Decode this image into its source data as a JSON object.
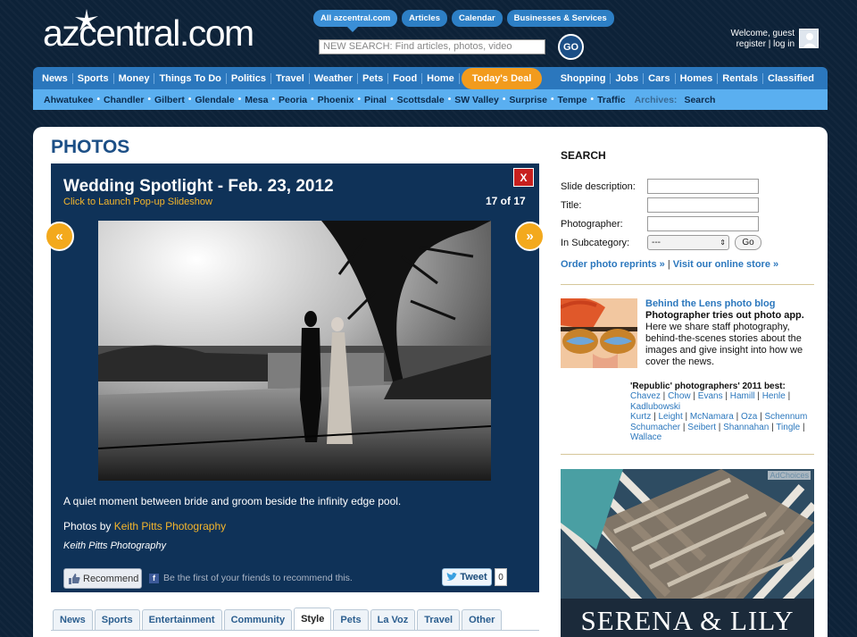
{
  "header": {
    "logo": "azcentral.com",
    "top_tabs": [
      "All azcentral.com",
      "Articles",
      "Calendar",
      "Businesses & Services"
    ],
    "search_placeholder": "NEW SEARCH: Find articles, photos, video",
    "go_label": "GO",
    "welcome_line1": "Welcome, guest",
    "welcome_line2": "register | log in"
  },
  "nav_primary": {
    "left": [
      "News",
      "Sports",
      "Money",
      "Things To Do",
      "Politics",
      "Travel",
      "Weather",
      "Pets",
      "Food",
      "Home"
    ],
    "deal": "Today's Deal",
    "right": [
      "Shopping",
      "Jobs",
      "Cars",
      "Homes",
      "Rentals",
      "Classified"
    ]
  },
  "nav_secondary": {
    "items": [
      "Ahwatukee",
      "Chandler",
      "Gilbert",
      "Glendale",
      "Mesa",
      "Peoria",
      "Phoenix",
      "Pinal",
      "Scottsdale",
      "SW Valley",
      "Surprise",
      "Tempe",
      "Traffic"
    ],
    "archives": "Archives:",
    "search": "Search"
  },
  "page_title": "PHOTOS",
  "slideshow": {
    "title": "Wedding Spotlight - Feb. 23, 2012",
    "launch": "Click to Launch Pop-up Slideshow",
    "counter": "17 of 17",
    "close": "X",
    "prev_icon": "«",
    "next_icon": "»",
    "caption": "A quiet moment between bride and groom beside the infinity edge pool.",
    "credit_prefix": "Photos by",
    "credit_link": "Keith Pitts Photography",
    "credit_italic": "Keith Pitts Photography",
    "recommend": "Recommend",
    "fb_text": "Be the first of your friends to recommend this.",
    "tweet": "Tweet",
    "tweet_count": "0"
  },
  "category_tabs": [
    "News",
    "Sports",
    "Entertainment",
    "Community",
    "Style",
    "Pets",
    "La Voz",
    "Travel",
    "Other"
  ],
  "active_tab": "Style",
  "sidebar": {
    "search_heading": "SEARCH",
    "fields": [
      "Slide description:",
      "Title:",
      "Photographer:",
      "In Subcategory:"
    ],
    "select_value": "---",
    "go": "Go",
    "order_reprints": "Order photo reprints »",
    "visit_store": "Visit our online store »",
    "blog_title": "Behind the Lens photo blog",
    "blog_subtitle": "Photographer tries out photo app.",
    "blog_text": "Here we share staff photography, behind-the-scenes stories about the images and give insight into how we cover the news.",
    "photographers_heading": "'Republic' photographers' 2011 best:",
    "photographers": [
      "Chavez",
      "Chow",
      "Evans",
      "Hamill",
      "Henle",
      "Kadlubowski",
      "Kurtz",
      "Leight",
      "McNamara",
      "Oza",
      "Schennum",
      "Schumacher",
      "Seibert",
      "Shannahan",
      "Tingle",
      "Wallace"
    ],
    "ad_choices": "AdChoices",
    "ad_brand": "SERENA & LILY"
  }
}
